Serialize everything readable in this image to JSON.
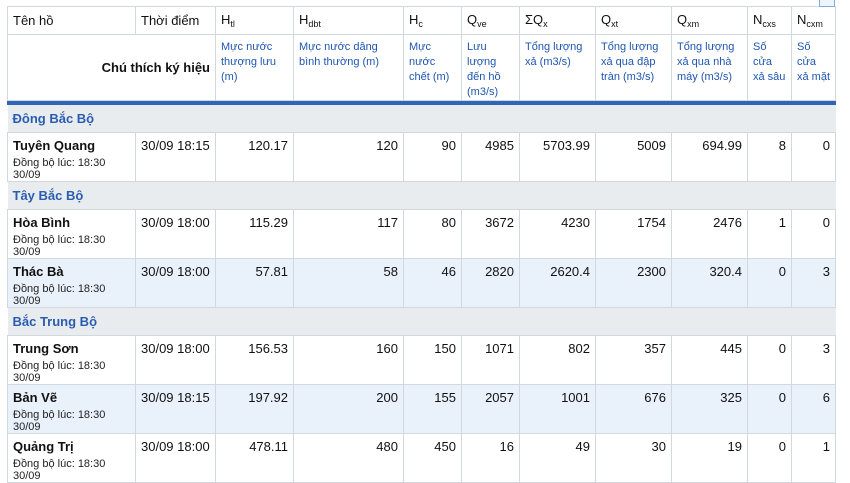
{
  "header": {
    "cols": [
      {
        "main": "Tên hồ",
        "sub": ""
      },
      {
        "main": "Thời điểm",
        "sub": ""
      },
      {
        "main": "H",
        "sub": "tl"
      },
      {
        "main": "H",
        "sub": "dbt"
      },
      {
        "main": "H",
        "sub": "c"
      },
      {
        "main": "Q",
        "sub": "ve"
      },
      {
        "main": "ΣQ",
        "sub": "x"
      },
      {
        "main": "Q",
        "sub": "xt"
      },
      {
        "main": "Q",
        "sub": "xm"
      },
      {
        "main": "N",
        "sub": "cxs"
      },
      {
        "main": "N",
        "sub": "cxm"
      }
    ],
    "legend_title": "Chú thích ký hiệu",
    "legends": [
      "Mực nước thượng lưu (m)",
      "Mực nước dâng bình thường (m)",
      "Mực nước chết (m)",
      "Lưu lượng đến hồ (m3/s)",
      "Tổng lượng xả (m3/s)",
      "Tổng lượng xả qua đập tràn (m3/s)",
      "Tổng lượng xả qua nhà máy (m3/s)",
      "Số cửa xả sâu",
      "Số cửa xả mặt"
    ]
  },
  "regions": [
    {
      "name": "Đông Bắc Bộ",
      "rows": [
        {
          "name": "Tuyên Quang",
          "sync": "Đồng bộ lúc: 18:30 30/09",
          "time": "30/09 18:15",
          "htl": "120.17",
          "hdbt": "120",
          "hc": "90",
          "qve": "4985",
          "sqx": "5703.99",
          "qxt": "5009",
          "qxm": "694.99",
          "ncxs": "8",
          "ncxm": "0"
        }
      ]
    },
    {
      "name": "Tây Bắc Bộ",
      "rows": [
        {
          "name": "Hòa Bình",
          "sync": "Đồng bộ lúc: 18:30 30/09",
          "time": "30/09 18:00",
          "htl": "115.29",
          "hdbt": "117",
          "hc": "80",
          "qve": "3672",
          "sqx": "4230",
          "qxt": "1754",
          "qxm": "2476",
          "ncxs": "1",
          "ncxm": "0"
        },
        {
          "name": "Thác Bà",
          "sync": "Đồng bộ lúc: 18:30 30/09",
          "time": "30/09 18:00",
          "htl": "57.81",
          "hdbt": "58",
          "hc": "46",
          "qve": "2820",
          "sqx": "2620.4",
          "qxt": "2300",
          "qxm": "320.4",
          "ncxs": "0",
          "ncxm": "3"
        }
      ]
    },
    {
      "name": "Bắc Trung Bộ",
      "rows": [
        {
          "name": "Trung Sơn",
          "sync": "Đồng bộ lúc: 18:30 30/09",
          "time": "30/09 18:00",
          "htl": "156.53",
          "hdbt": "160",
          "hc": "150",
          "qve": "1071",
          "sqx": "802",
          "qxt": "357",
          "qxm": "445",
          "ncxs": "0",
          "ncxm": "3"
        },
        {
          "name": "Bản Vẽ",
          "sync": "Đồng bộ lúc: 18:30 30/09",
          "time": "30/09 18:15",
          "htl": "197.92",
          "hdbt": "200",
          "hc": "155",
          "qve": "2057",
          "sqx": "1001",
          "qxt": "676",
          "qxm": "325",
          "ncxs": "0",
          "ncxm": "6"
        },
        {
          "name": "Quảng Trị",
          "sync": "Đồng bộ lúc: 18:30 30/09",
          "time": "30/09 18:00",
          "htl": "478.11",
          "hdbt": "480",
          "hc": "450",
          "qve": "16",
          "sqx": "49",
          "qxt": "30",
          "qxm": "19",
          "ncxs": "0",
          "ncxm": "1"
        }
      ]
    }
  ],
  "corner_icon": "collapse-icon",
  "colors": {
    "accent": "#2a5db0",
    "rule": "#2f66b8",
    "alt_row": "#e9f1fb",
    "region_bg": "#e9ecef"
  }
}
